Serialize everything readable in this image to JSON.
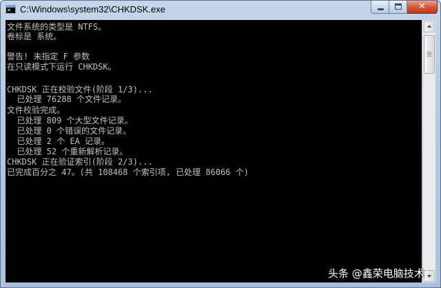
{
  "window": {
    "title": "C:\\Windows\\system32\\CHKDSK.exe",
    "icon": "console-app-icon",
    "buttons": {
      "minimize": "minimize-icon",
      "maximize": "maximize-icon",
      "close": "✕"
    }
  },
  "console": {
    "text_color": "#c0c0c0",
    "background": "#000000",
    "lines": [
      "文件系统的类型是 NTFS。",
      "卷标是 系统。",
      "",
      "警告! 未指定 F 参数",
      "在只读模式下运行 CHKDSK。",
      "",
      "CHKDSK 正在校验文件(阶段 1/3)...",
      "  已处理 76288 个文件记录。",
      "文件校验完成。",
      "  已处理 809 个大型文件记录。",
      "  已处理 0 个错误的文件记录。",
      "  已处理 2 个 EA 记录。",
      "  已处理 52 个重新解析记录。",
      "CHKDSK 正在验证索引(阶段 2/3)...",
      "已完成百分之 47。(共 108468 个索引项, 已处理 86066 个)"
    ]
  },
  "watermark": "头条 @鑫荣电脑技术"
}
